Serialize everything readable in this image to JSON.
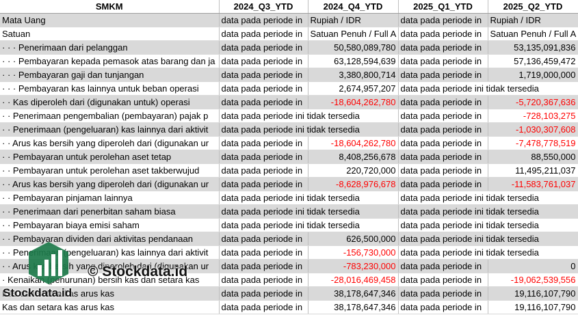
{
  "header": [
    "SMKM",
    "2024_Q3_YTD",
    "2024_Q4_YTD",
    "2025_Q1_YTD",
    "2025_Q2_YTD"
  ],
  "rows": [
    [
      "Mata Uang",
      "data pada periode in",
      "Rupiah / IDR",
      "data pada periode in",
      "Rupiah / IDR"
    ],
    [
      "Satuan",
      "data pada periode in",
      "Satuan Penuh / Full A",
      "data pada periode in",
      "Satuan Penuh / Full A"
    ],
    [
      "· · · Penerimaan dari pelanggan",
      "data pada periode in",
      "50,580,089,780",
      "data pada periode in",
      "53,135,091,836"
    ],
    [
      "· · · Pembayaran kepada pemasok atas barang dan ja",
      "data pada periode in",
      "63,128,594,639",
      "data pada periode in",
      "57,136,459,472"
    ],
    [
      "· · · Pembayaran gaji dan tunjangan",
      "data pada periode in",
      "3,380,800,714",
      "data pada periode in",
      "1,719,000,000"
    ],
    [
      "· · · Pembayaran kas lainnya untuk beban operasi",
      "data pada periode in",
      "2,674,957,207",
      "data pada periode ini tidak tersedia",
      ""
    ],
    [
      "· · Kas diperoleh dari (digunakan untuk) operasi",
      "data pada periode in",
      "-18,604,262,780",
      "data pada periode in",
      "-5,720,367,636"
    ],
    [
      "· · Penerimaan pengembalian (pembayaran) pajak p",
      "data pada periode ini tidak tersedia",
      "",
      "data pada periode in",
      "-728,103,275"
    ],
    [
      "· · Penerimaan (pengeluaran) kas lainnya dari aktivit",
      "data pada periode ini tidak tersedia",
      "",
      "data pada periode in",
      "-1,030,307,608"
    ],
    [
      "· · Arus kas bersih yang diperoleh dari (digunakan ur",
      "data pada periode in",
      "-18,604,262,780",
      "data pada periode in",
      "-7,478,778,519"
    ],
    [
      "· · Pembayaran untuk perolehan aset tetap",
      "data pada periode in",
      "8,408,256,678",
      "data pada periode in",
      "88,550,000"
    ],
    [
      "· · Pembayaran untuk perolehan aset takberwujud",
      "data pada periode in",
      "220,720,000",
      "data pada periode in",
      "11,495,211,037"
    ],
    [
      "· · Arus kas bersih yang diperoleh dari (digunakan ur",
      "data pada periode in",
      "-8,628,976,678",
      "data pada periode in",
      "-11,583,761,037"
    ],
    [
      "· · Pembayaran pinjaman lainnya",
      "data pada periode ini tidak tersedia",
      "",
      "data pada periode ini tidak tersedia",
      ""
    ],
    [
      "· · Penerimaan dari penerbitan saham biasa",
      "data pada periode ini tidak tersedia",
      "",
      "data pada periode ini tidak tersedia",
      ""
    ],
    [
      "· · Pembayaran biaya emisi saham",
      "data pada periode ini tidak tersedia",
      "",
      "data pada periode ini tidak tersedia",
      ""
    ],
    [
      "· · Pembayaran dividen dari aktivitas pendanaan",
      "data pada periode in",
      "626,500,000",
      "data pada periode ini tidak tersedia",
      ""
    ],
    [
      "· · Penerimaan (pengeluaran) kas lainnya dari aktivit",
      "data pada periode in",
      "-156,730,000",
      "data pada periode ini tidak tersedia",
      ""
    ],
    [
      "· · Arus kas bersih yang diperoleh dari (digunakan ur",
      "data pada periode in",
      "-783,230,000",
      "data pada periode in",
      "0"
    ],
    [
      "· Kenaikan (penurunan) bersih kas dan setara kas",
      "data pada periode in",
      "-28,016,469,458",
      "data pada periode in",
      "-19,062,539,556"
    ],
    [
      "Kas dan setara kas arus kas",
      "data pada periode in",
      "38,178,647,346",
      "data pada periode in",
      "19,116,107,790"
    ],
    [
      "Kas dan setara kas arus kas",
      "data pada periode in",
      "38,178,647,346",
      "data pada periode in",
      "19,116,107,790"
    ]
  ],
  "watermark": {
    "copyright": "© Stockdata.id",
    "brand": "Stockdata.id"
  },
  "colors": {
    "negative": "#ff0000",
    "stripe": "#d9d9d9",
    "logo": "#1c7a4a"
  }
}
